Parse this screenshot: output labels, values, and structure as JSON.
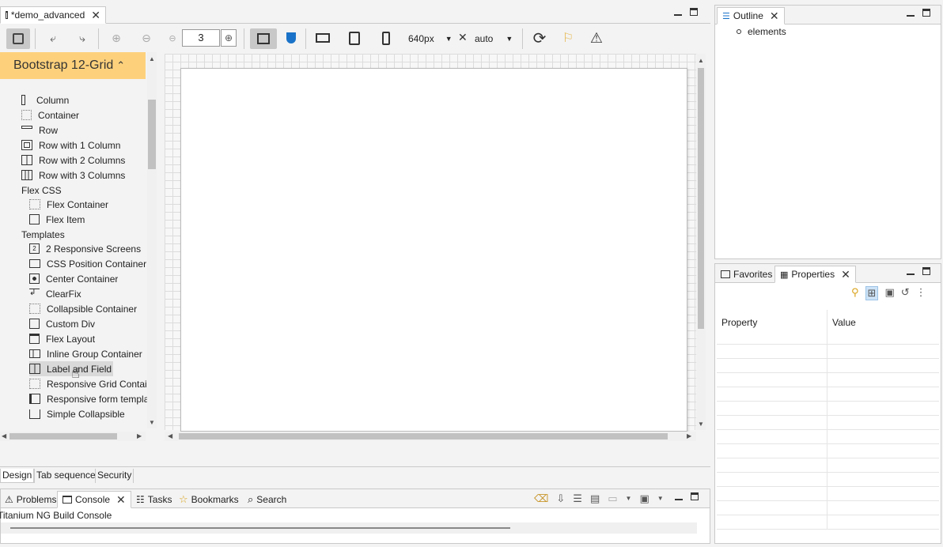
{
  "editor": {
    "tab_title": "*demo_advanced",
    "zoom_value": "3",
    "width_value": "640px",
    "height_value": "auto"
  },
  "palette": {
    "header": "Bootstrap 12-Grid",
    "items": [
      {
        "label": "Column",
        "icon": "column-icon"
      },
      {
        "label": "Container",
        "icon": "container-icon"
      },
      {
        "label": "Row",
        "icon": "row-icon"
      },
      {
        "label": "Row with 1 Column",
        "icon": "row-1col-icon"
      },
      {
        "label": "Row with 2 Columns",
        "icon": "row-2col-icon"
      },
      {
        "label": "Row with 3 Columns",
        "icon": "row-3col-icon"
      }
    ],
    "flex_section": "Flex CSS",
    "flex_items": [
      {
        "label": "Flex Container"
      },
      {
        "label": "Flex Item"
      }
    ],
    "templates_section": "Templates",
    "template_items": [
      {
        "label": "2 Responsive Screens"
      },
      {
        "label": "CSS Position Container"
      },
      {
        "label": "Center Container"
      },
      {
        "label": "ClearFix"
      },
      {
        "label": "Collapsible Container"
      },
      {
        "label": "Custom Div"
      },
      {
        "label": "Flex Layout"
      },
      {
        "label": "Inline Group Container"
      },
      {
        "label": "Label and Field"
      },
      {
        "label": "Responsive Grid Contain"
      },
      {
        "label": "Responsive form templa"
      },
      {
        "label": "Simple Collapsible"
      }
    ]
  },
  "bottom_tabs": {
    "design": "Design",
    "tab_sequence": "Tab sequence",
    "security": "Security"
  },
  "console_panel": {
    "tabs": {
      "problems": "Problems",
      "console": "Console",
      "tasks": "Tasks",
      "bookmarks": "Bookmarks",
      "search": "Search"
    },
    "content": "Titanium NG Build Console"
  },
  "outline": {
    "title": "Outline",
    "item": "elements"
  },
  "properties": {
    "favorites_tab": "Favorites",
    "properties_tab": "Properties",
    "col_property": "Property",
    "col_value": "Value"
  },
  "colors": {
    "palette_header": "#fdd17c",
    "selected_item": "#d9d9d9",
    "accent_blue": "#1a73c8"
  }
}
